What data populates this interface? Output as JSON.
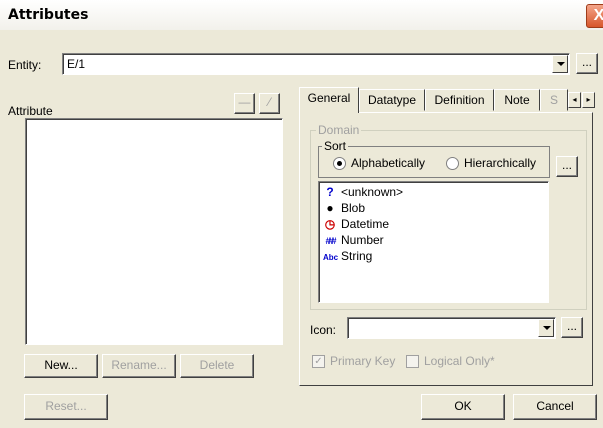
{
  "window": {
    "title": "Attributes",
    "close_glyph": "X"
  },
  "entity": {
    "label": "Entity:",
    "value": "E/1",
    "browse_label": "..."
  },
  "attribute_list": {
    "label": "Attribute",
    "toolbar": {
      "button_1_glyph": "—",
      "button_2_glyph": "⁄"
    }
  },
  "attribute_buttons": {
    "new": "New...",
    "rename": "Rename...",
    "delete": "Delete"
  },
  "tabs": [
    {
      "label": "General",
      "active": true
    },
    {
      "label": "Datatype",
      "active": false
    },
    {
      "label": "Definition",
      "active": false
    },
    {
      "label": "Note",
      "active": false
    },
    {
      "label": "S",
      "active": false
    }
  ],
  "tab_scroll": {
    "left_glyph": "◂",
    "right_glyph": "▸"
  },
  "general": {
    "domain_group": "Domain",
    "sort_group": "Sort",
    "sort_options": [
      {
        "label": "Alphabetically",
        "checked": true
      },
      {
        "label": "Hierarchically",
        "checked": false
      }
    ],
    "sort_browse_label": "...",
    "domains": [
      {
        "icon": "?",
        "icon_name": "question-mark-icon",
        "icon_color": "#0000cc",
        "label": "<unknown>"
      },
      {
        "icon": "●",
        "icon_name": "blob-icon",
        "icon_color": "#000000",
        "label": "Blob"
      },
      {
        "icon": "◷",
        "icon_name": "clock-icon",
        "icon_color": "#cc0000",
        "label": "Datetime"
      },
      {
        "icon": "###",
        "icon_name": "number-icon",
        "icon_color": "#0000cc",
        "label": "Number"
      },
      {
        "icon": "Abc",
        "icon_name": "string-icon",
        "icon_color": "#0000cc",
        "label": "String"
      }
    ],
    "icon_label": "Icon:",
    "icon_value": "",
    "icon_browse_label": "...",
    "primary_key": {
      "label": "Primary Key",
      "checked": true
    },
    "logical_only": {
      "label": "Logical Only*",
      "checked": false
    }
  },
  "footer": {
    "reset": "Reset...",
    "ok": "OK",
    "cancel": "Cancel"
  }
}
